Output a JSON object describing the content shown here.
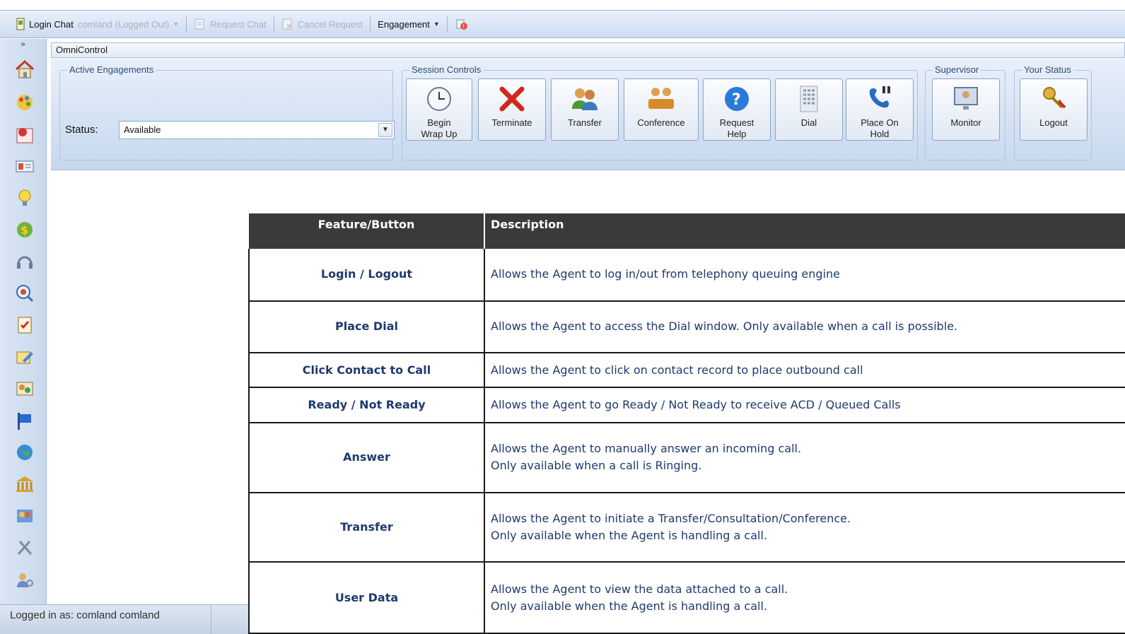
{
  "toolbar": {
    "login_chat": "Login Chat",
    "user_dropdown": "comland (Logged Out)",
    "request_chat": "Request Chat",
    "cancel_request": "Cancel Request",
    "engagement": "Engagement"
  },
  "panel": {
    "title": "OmniControl",
    "active_engagements": "Active Engagements",
    "status_label": "Status:",
    "status_value": "Available",
    "session_controls": "Session Controls",
    "supervisor": "Supervisor",
    "your_status": "Your Status",
    "buttons": {
      "begin_wrap_up_1": "Begin",
      "begin_wrap_up_2": "Wrap Up",
      "terminate": "Terminate",
      "transfer": "Transfer",
      "conference": "Conference",
      "request_help_1": "Request",
      "request_help_2": "Help",
      "dial": "Dial",
      "place_on_hold_1": "Place On",
      "place_on_hold_2": "Hold",
      "monitor": "Monitor",
      "logout": "Logout"
    }
  },
  "rail": {
    "expand": "»"
  },
  "table": {
    "header_feature": "Feature/Button",
    "header_description": "Description",
    "rows": [
      {
        "feature": "Login / Logout",
        "desc1": "Allows the Agent to log in/out from telephony queuing engine",
        "desc2": ""
      },
      {
        "feature": "Place Dial",
        "desc1": "Allows the Agent to access the Dial window.   Only available when a call is possible.",
        "desc2": ""
      },
      {
        "feature": "Click Contact to Call",
        "desc1": "Allows the Agent to click on contact record to place outbound call",
        "desc2": ""
      },
      {
        "feature": "Ready / Not Ready",
        "desc1": "Allows the Agent to go Ready / Not Ready to receive ACD / Queued Calls",
        "desc2": ""
      },
      {
        "feature": "Answer",
        "desc1": "Allows the Agent to manually answer an incoming call.",
        "desc2": "Only available when a call is Ringing."
      },
      {
        "feature": "Transfer",
        "desc1": "Allows the Agent to initiate a Transfer/Consultation/Conference.",
        "desc2": "Only available when the Agent is handling a call."
      },
      {
        "feature": "User Data",
        "desc1": "Allows the Agent to view the data attached to a call.",
        "desc2": "Only available when the Agent is handling a call."
      }
    ]
  },
  "statusbar": {
    "text": "Logged in as: comland comland"
  },
  "colors": {
    "table_header_bg": "#3a3a3a",
    "table_text": "#1f3a6e",
    "toolbar_bg": "#cddcf0"
  }
}
